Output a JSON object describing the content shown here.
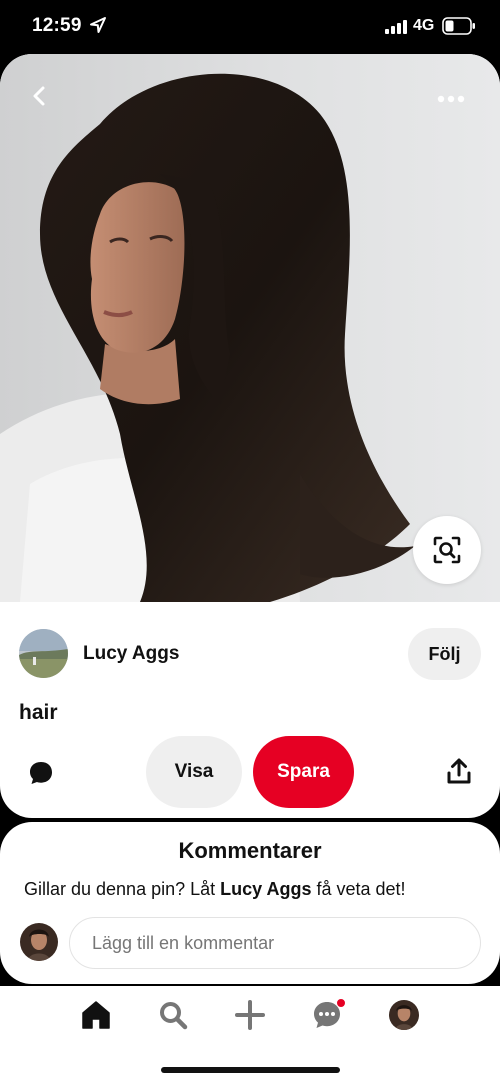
{
  "status_bar": {
    "time": "12:59",
    "network": "4G",
    "icons": [
      "location-arrow-icon",
      "signal-bars-icon",
      "battery-icon"
    ]
  },
  "pin": {
    "image_description_icon": "photo",
    "creator_name": "Lucy Aggs",
    "follow_label": "Följ",
    "title": "hair",
    "visa_label": "Visa",
    "save_label": "Spara",
    "icons": [
      "back-chevron-icon",
      "more-dots-icon",
      "visual-search-icon",
      "comment-bubble-icon",
      "share-icon"
    ]
  },
  "comments": {
    "title": "Kommentarer",
    "prompt_before": "Gillar du denna pin? Låt ",
    "prompt_name": "Lucy Aggs",
    "prompt_after": " få veta det!",
    "input_placeholder": "Lägg till en kommentar"
  },
  "bottom_nav": {
    "items": [
      "home-icon",
      "search-icon",
      "plus-icon",
      "messages-icon",
      "profile-avatar"
    ],
    "active": "home-icon",
    "messages_has_notification": true
  },
  "colors": {
    "accent": "#e60023",
    "button_gray": "#efefef",
    "text": "#111111"
  }
}
